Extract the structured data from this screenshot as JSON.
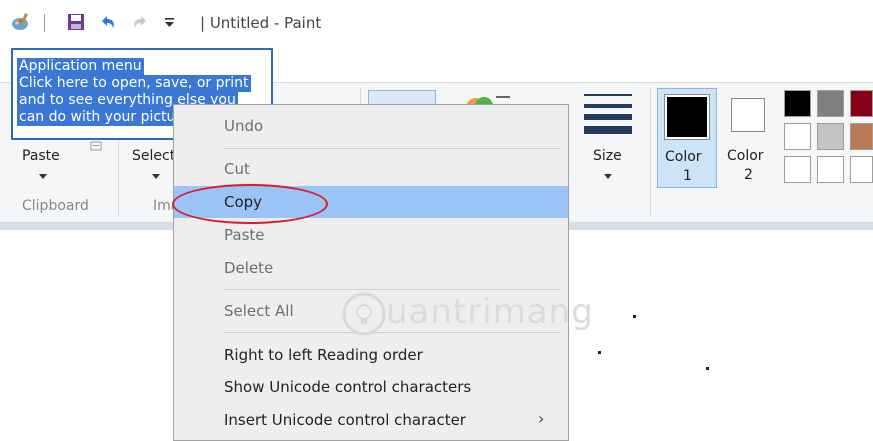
{
  "window": {
    "title": "| Untitled - Paint"
  },
  "tooltip": {
    "lines": [
      "Application menu",
      "Click here to open, save, or print",
      "and to see everything else you",
      "can do with your picture."
    ]
  },
  "ribbon": {
    "paste_label": "Paste",
    "select_label": "Select",
    "clipboard_label": "Clipboard",
    "image_label": "Image",
    "size_label": "Size",
    "color1_line1": "Color",
    "color1_line2": "1",
    "color2_line1": "Color",
    "color2_line2": "2"
  },
  "palette": {
    "colors": [
      "#000000",
      "#7f7f7f",
      "#880015",
      "#ffffff",
      "#c3c3c3",
      "#b97a57",
      "#ffffff",
      "#ffffff",
      "#ffffff"
    ]
  },
  "context_menu": {
    "items": [
      {
        "label": "Undo",
        "state": "disabled"
      },
      {
        "label": "Cut",
        "state": "disabled"
      },
      {
        "label": "Copy",
        "state": "active"
      },
      {
        "label": "Paste",
        "state": "disabled"
      },
      {
        "label": "Delete",
        "state": "disabled"
      },
      {
        "label": "Select All",
        "state": "disabled"
      },
      {
        "label": "Right to left Reading order",
        "state": "normal"
      },
      {
        "label": "Show Unicode control characters",
        "state": "normal"
      },
      {
        "label": "Insert Unicode control character",
        "state": "normal"
      }
    ],
    "submenu_arrow": "›"
  },
  "icons": {
    "app": "paint-app-icon",
    "save": "save-icon",
    "undo": "undo-icon",
    "redo": "redo-icon",
    "customize": "customize-qat-icon"
  },
  "accent": {
    "highlight": "#9ac4f5",
    "annotation": "#e0192a",
    "selection": "#3b78d6"
  },
  "watermark": {
    "text": "uantrimang"
  }
}
